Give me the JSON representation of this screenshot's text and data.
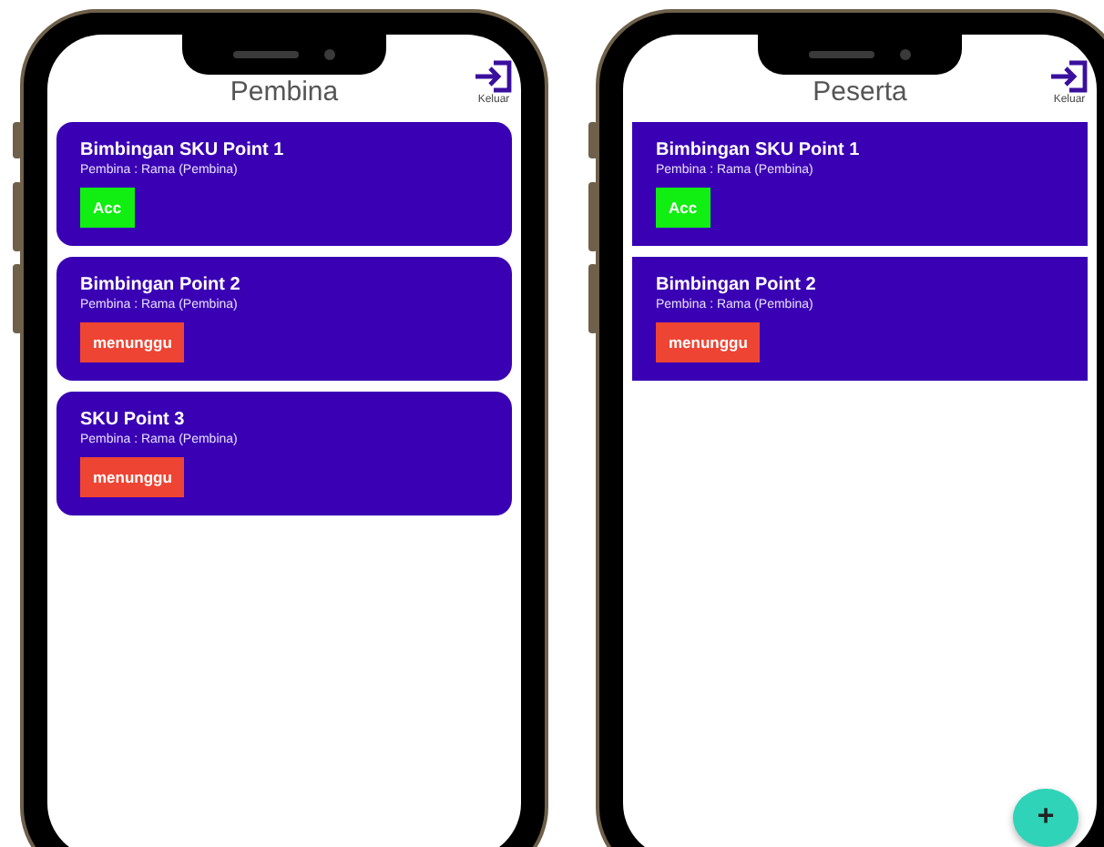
{
  "phones": [
    {
      "title": "Pembina",
      "logout_label": "Keluar",
      "rounded_cards": true,
      "items": [
        {
          "title": "Bimbingan SKU Point 1",
          "subtitle": "Pembina : Rama (Pembina)",
          "status": {
            "label": "Acc",
            "kind": "approved"
          }
        },
        {
          "title": "Bimbingan Point 2",
          "subtitle": "Pembina : Rama (Pembina)",
          "status": {
            "label": "menunggu",
            "kind": "pending"
          }
        },
        {
          "title": "SKU Point 3",
          "subtitle": "Pembina : Rama (Pembina)",
          "status": {
            "label": "menunggu",
            "kind": "pending"
          }
        }
      ]
    },
    {
      "title": "Peserta",
      "logout_label": "Keluar",
      "rounded_cards": false,
      "items": [
        {
          "title": "Bimbingan SKU Point 1",
          "subtitle": "Pembina : Rama (Pembina)",
          "status": {
            "label": "Acc",
            "kind": "approved"
          }
        },
        {
          "title": "Bimbingan Point 2",
          "subtitle": "Pembina : Rama (Pembina)",
          "status": {
            "label": "menunggu",
            "kind": "pending"
          }
        }
      ],
      "fab": {
        "label": "+"
      }
    }
  ]
}
